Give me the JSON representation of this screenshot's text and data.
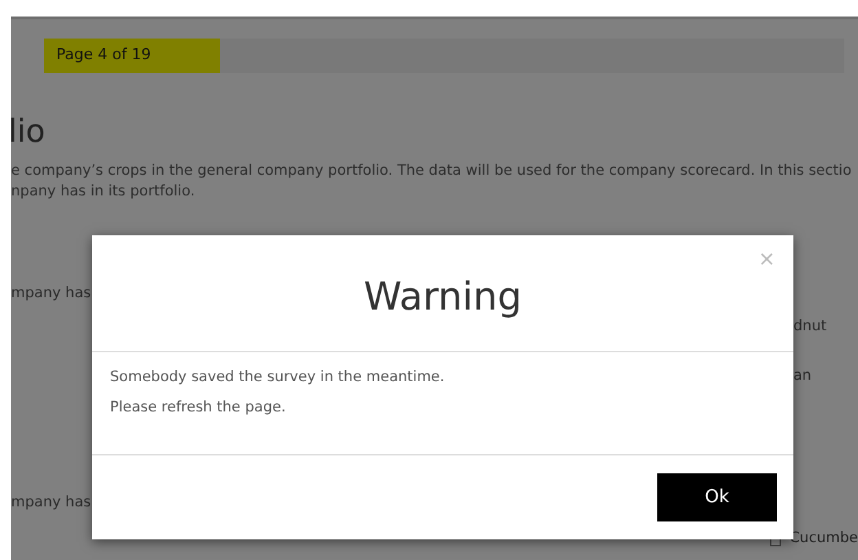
{
  "progress": {
    "label": "Page 4 of 19",
    "level": 0.22
  },
  "page": {
    "heading": "lio",
    "intro_lines": [
      "e company’s crops in the general company portfolio. The data will be used for the company scorecard. In this sectio",
      "npany has in its portfolio."
    ],
    "question_1": "mpany has",
    "question_1_right": [
      "dnut",
      "an"
    ],
    "question_2": "mpany has",
    "question_2_right": [
      {
        "label": "Cucumbe",
        "checked": false
      }
    ]
  },
  "dialog": {
    "title": "Warning",
    "close": "×",
    "messages": [
      "Somebody saved the survey in the meantime.",
      "Please refresh the page."
    ],
    "button": "Ok"
  }
}
